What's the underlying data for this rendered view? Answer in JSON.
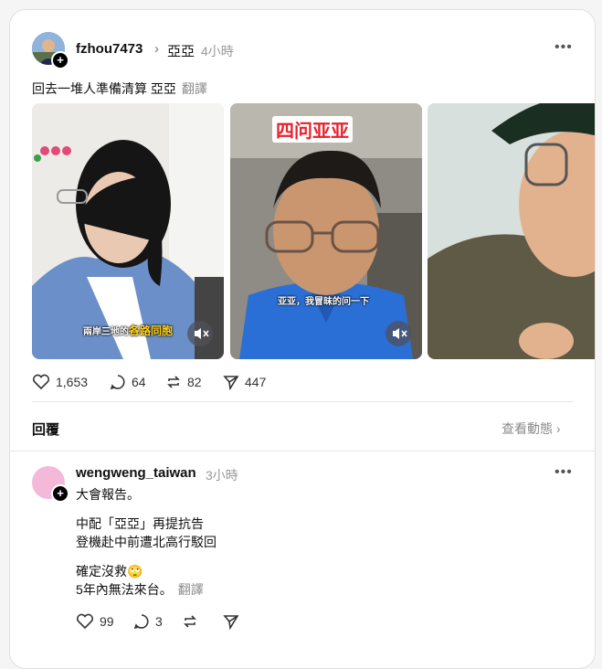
{
  "post": {
    "username": "fzhou7473",
    "tag": "亞亞",
    "time": "4小時",
    "text": "回去一堆人準備清算 亞亞",
    "translate": "翻譯",
    "stats": {
      "likes": "1,653",
      "comments": "64",
      "reposts": "82",
      "shares": "447"
    },
    "media": [
      {
        "caption_a": "兩岸三地的",
        "caption_b": "各路同胞"
      },
      {
        "banner": "四问亚亚",
        "caption": "亚亚，我冒昧的问一下"
      },
      {
        "caption": ""
      }
    ]
  },
  "replies_bar": {
    "label": "回覆",
    "view_activity": "查看動態"
  },
  "reply": {
    "username": "wengweng_taiwan",
    "time": "3小時",
    "lines": [
      "大會報告。",
      "",
      "中配「亞亞」再提抗告",
      "登機赴中前遭北高行駁回",
      "",
      "確定沒救🙄",
      "5年內無法來台。"
    ],
    "translate": "翻譯",
    "stats": {
      "likes": "99",
      "comments": "3"
    }
  },
  "colors": {
    "reply_avatar": "#f4b8d8",
    "banner_red": "#e8202a",
    "shirt_blue": "#2a6fd6"
  }
}
